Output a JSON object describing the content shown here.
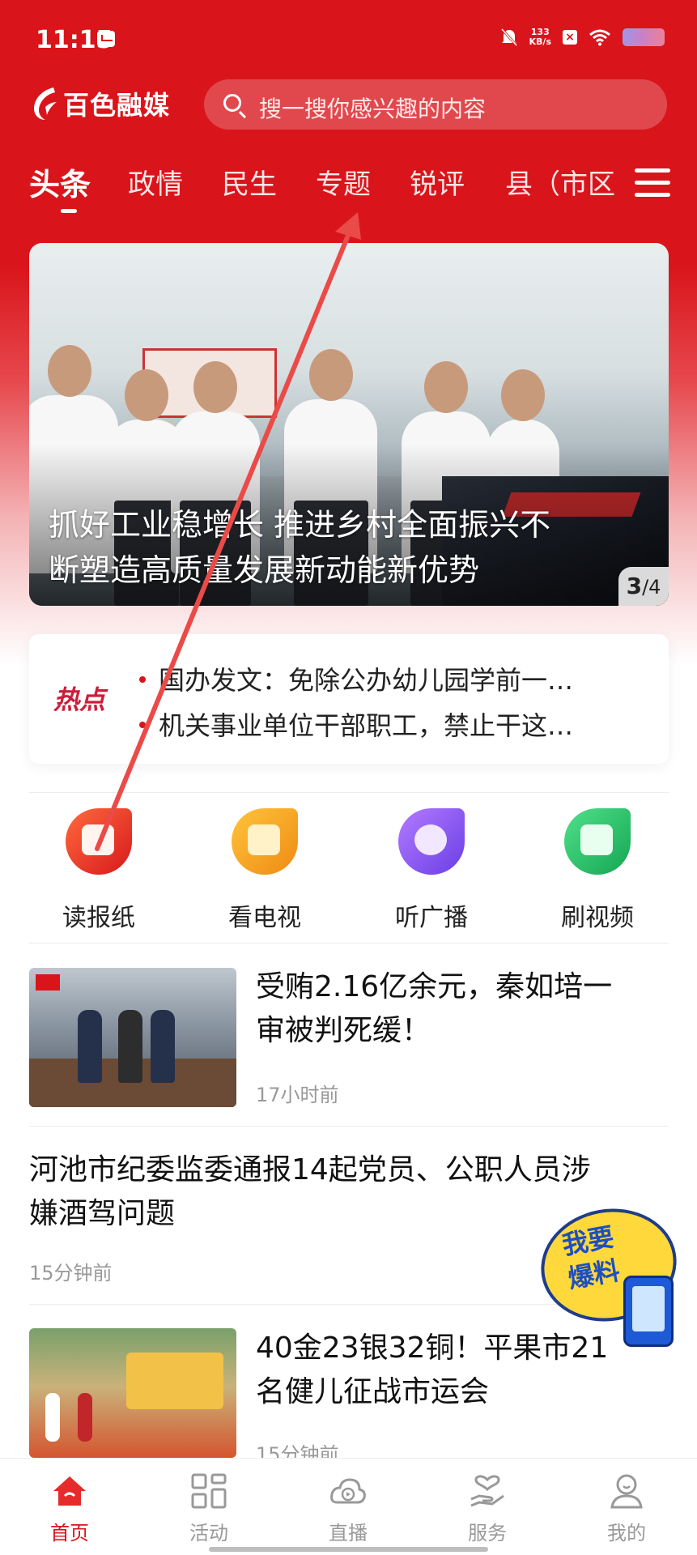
{
  "status_bar": {
    "time": "11:15",
    "net_speed_value": "133",
    "net_speed_unit": "KB/s"
  },
  "header": {
    "logo_text": "百色融媒",
    "search_placeholder": "搜一搜你感兴趣的内容"
  },
  "tabs": [
    {
      "label": "头条",
      "active": true
    },
    {
      "label": "政情"
    },
    {
      "label": "民生"
    },
    {
      "label": "专题"
    },
    {
      "label": "锐评"
    },
    {
      "label": "县（市区"
    }
  ],
  "banner": {
    "title_line1": "抓好工业稳增长 推进乡村全面振兴不",
    "title_line2": "断塑造高质量发展新动能新优势",
    "page_current": "3",
    "page_total": "/4"
  },
  "hot": {
    "label": "热点",
    "items": [
      "国办发文：免除公办幼儿园学前一…",
      "机关事业单位干部职工，禁止干这…"
    ]
  },
  "quick_entries": [
    {
      "label": "读报纸",
      "icon": "newspaper-icon",
      "color": "#e8231f"
    },
    {
      "label": "看电视",
      "icon": "tv-icon",
      "color": "#f2a21b"
    },
    {
      "label": "听广播",
      "icon": "radio-icon",
      "color": "#8a4cf0"
    },
    {
      "label": "刷视频",
      "icon": "video-icon",
      "color": "#26c26a"
    }
  ],
  "news": [
    {
      "title_line1": "受贿2.16亿余元，秦如培一",
      "title_line2": "审被判死缓！",
      "time": "17小时前"
    },
    {
      "title_line1": "河池市纪委监委通报14起党员、公职人员涉",
      "title_line2": "嫌酒驾问题",
      "time": "15分钟前"
    },
    {
      "title_line1": "40金23银32铜！平果市21",
      "title_line2": "名健儿征战市运会",
      "time": "15分钟前"
    }
  ],
  "badge": {
    "line1": "我要",
    "line2": "爆料"
  },
  "bottom_nav": [
    {
      "label": "首页",
      "icon": "home-icon",
      "active": true
    },
    {
      "label": "活动",
      "icon": "grid-icon"
    },
    {
      "label": "直播",
      "icon": "live-icon"
    },
    {
      "label": "服务",
      "icon": "heart-hand-icon"
    },
    {
      "label": "我的",
      "icon": "profile-icon"
    }
  ],
  "colors": {
    "brand_red": "#d9151b",
    "hot_label": "#cc1e3a",
    "muted_text": "#999999"
  }
}
